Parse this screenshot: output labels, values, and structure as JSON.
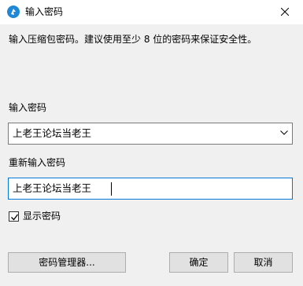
{
  "window": {
    "title": "输入密码",
    "app_icon": "app-logo-icon",
    "close_icon": "close-icon"
  },
  "description": "输入压缩包密码。建议使用至少 8 位的密码来保证安全性。",
  "password": {
    "label": "输入密码",
    "value": "上老王论坛当老王",
    "dropdown_icon": "chevron-down-icon"
  },
  "confirm_password": {
    "label": "重新输入密码",
    "value": "上老王论坛当老王"
  },
  "show_password": {
    "label": "显示密码",
    "checked": true
  },
  "buttons": {
    "manager": "密码管理器...",
    "ok": "确定",
    "cancel": "取消"
  },
  "colors": {
    "accent": "#0078d7",
    "app_icon": "#1e88d6"
  }
}
